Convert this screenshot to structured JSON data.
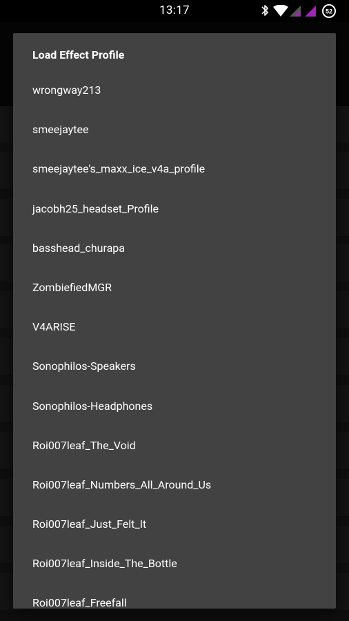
{
  "status_bar": {
    "time": "13:17",
    "battery_level": "52",
    "icons": [
      "bluetooth-icon",
      "wifi-icon",
      "signal-icon",
      "signal-icon",
      "battery-icon"
    ],
    "signal_color": "#9c27b0"
  },
  "dialog": {
    "title": "Load Effect Profile",
    "items": [
      "wrongway213",
      "smeejaytee",
      "smeejaytee's_maxx_ice_v4a_profile",
      "jacobh25_headset_Profile",
      "basshead_churapa",
      "ZombiefiedMGR",
      "V4ARISE",
      "Sonophilos-Speakers",
      "Sonophilos-Headphones",
      "Roi007leaf_The_Void",
      "Roi007leaf_Numbers_All_Around_Us",
      "Roi007leaf_Just_Felt_It",
      "Roi007leaf_Inside_The_Bottle",
      "Roi007leaf_Freefall"
    ]
  }
}
